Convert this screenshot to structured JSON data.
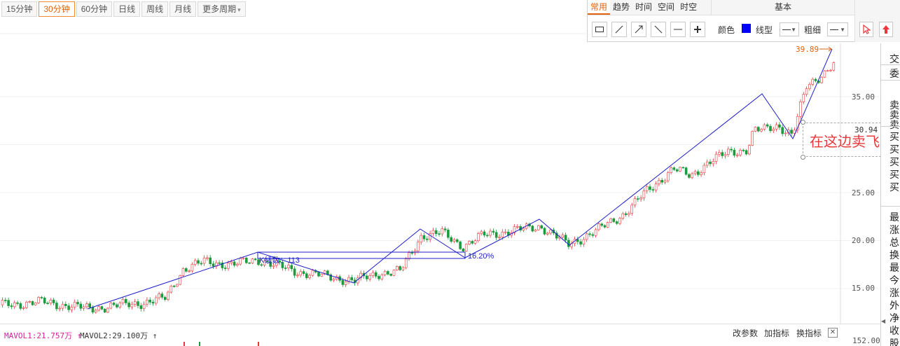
{
  "period_tabs": [
    {
      "label": "15分钟",
      "active": false
    },
    {
      "label": "30分钟",
      "active": true
    },
    {
      "label": "60分钟",
      "active": false
    },
    {
      "label": "日线",
      "active": false
    },
    {
      "label": "周线",
      "active": false
    },
    {
      "label": "月线",
      "active": false
    },
    {
      "label": "更多周期",
      "active": false
    }
  ],
  "toolbox": {
    "tabs": [
      "常用",
      "趋势",
      "时间",
      "空间",
      "时空"
    ],
    "active_tab": "常用",
    "basic_header": "基本",
    "tools": [
      "rectangle-icon",
      "line-segment-icon",
      "ray-icon",
      "ray-down-icon",
      "horizontal-line-icon",
      "crosshair-plus-icon"
    ],
    "color_label": "颜色",
    "line_color": "#0000ff",
    "line_type_label": "线型",
    "thickness_label": "粗细"
  },
  "price_axis": {
    "ticks": [
      "35.00",
      "30.94",
      "25.00",
      "20.00",
      "15.00"
    ],
    "current_price": "30.94",
    "high_price": "39.89"
  },
  "annotations": {
    "kline_count": "K线数：113",
    "percent": "16.20%",
    "sell_note": "在这边卖飞"
  },
  "side_panel": [
    "交",
    "委",
    "卖",
    "卖",
    "卖",
    "买",
    "买",
    "买",
    "买",
    "买",
    "最",
    "涨",
    "总",
    "换",
    "最",
    "今",
    "涨",
    "外",
    "净",
    "收",
    "股"
  ],
  "volume": {
    "mavol1": "MAVOL1:21.757万",
    "mavol2": "MAVOL2:29.100万",
    "actions": [
      "改参数",
      "加指标",
      "换指标"
    ],
    "axis_value": "152.00"
  },
  "colors": {
    "up": "#e8383b",
    "down": "#1a9b3c",
    "trend_line": "#1f1fcc",
    "accent": "#e0620d",
    "mavol1": "#d81e9b"
  }
}
